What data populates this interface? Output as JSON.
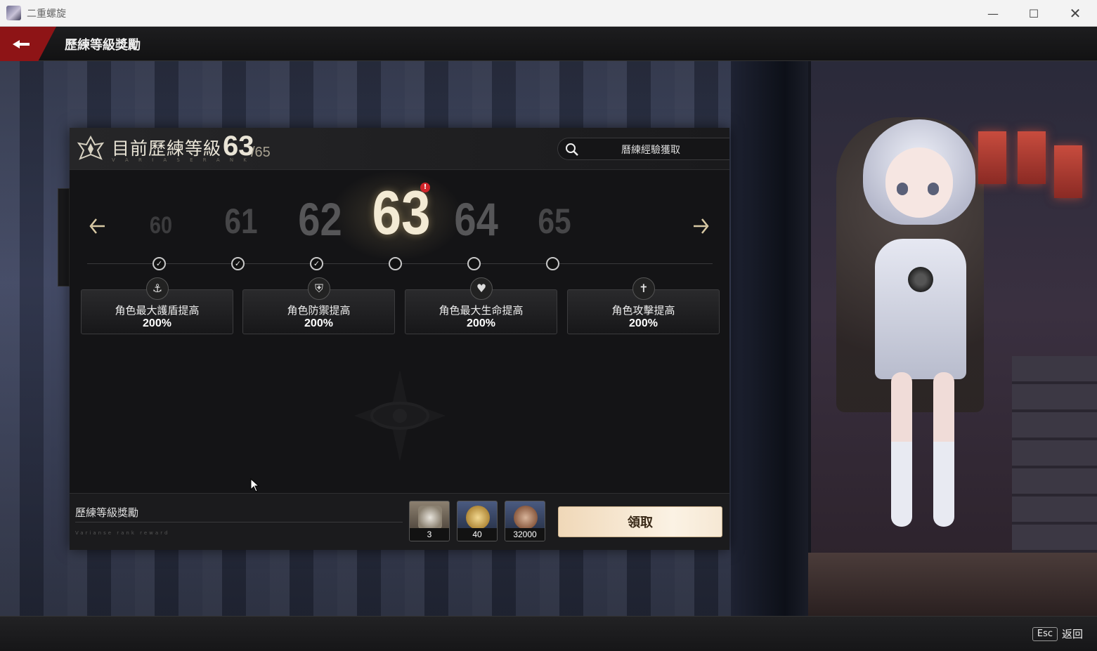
{
  "window": {
    "title": "二重螺旋",
    "minimize_glyph": "—",
    "maximize_glyph": "☐",
    "close_glyph": "✕"
  },
  "topbar": {
    "title": "歷練等級獎勵",
    "back_icon": "back-arrow-icon"
  },
  "panel": {
    "header_label": "目前歷練等級",
    "header_sub": "V A R I A S E   R A N K",
    "current_level": "63",
    "max_level": "/65",
    "search_label": "曆練經驗獲取"
  },
  "track": {
    "levels": [
      "60",
      "61",
      "62",
      "63",
      "64",
      "65"
    ],
    "badge": "!",
    "nodes": [
      "✓",
      "✓",
      "✓",
      "",
      "",
      ""
    ]
  },
  "bonuses": [
    {
      "icon": "shield-up-icon",
      "label": "角色最大護盾提高",
      "value": "200%"
    },
    {
      "icon": "defense-shield-icon",
      "label": "角色防禦提高",
      "value": "200%"
    },
    {
      "icon": "heart-icon",
      "label": "角色最大生命提高",
      "value": "200%"
    },
    {
      "icon": "sword-icon",
      "label": "角色攻擊提高",
      "value": "200%"
    }
  ],
  "rewards": {
    "title": "歷練等級獎勵",
    "deco": "Varianse rank reward",
    "items": [
      {
        "icon": "material-icon",
        "qty": "3"
      },
      {
        "icon": "gold-coin-icon",
        "qty": "40"
      },
      {
        "icon": "bronze-coin-icon",
        "qty": "32000"
      }
    ],
    "claim_label": "領取"
  },
  "bottombar": {
    "esc_key": "Esc",
    "esc_label": "返回"
  },
  "colors": {
    "accent_red": "#8e1416",
    "claim_button": "#f6e8d4",
    "badge_red": "#d0242a"
  }
}
